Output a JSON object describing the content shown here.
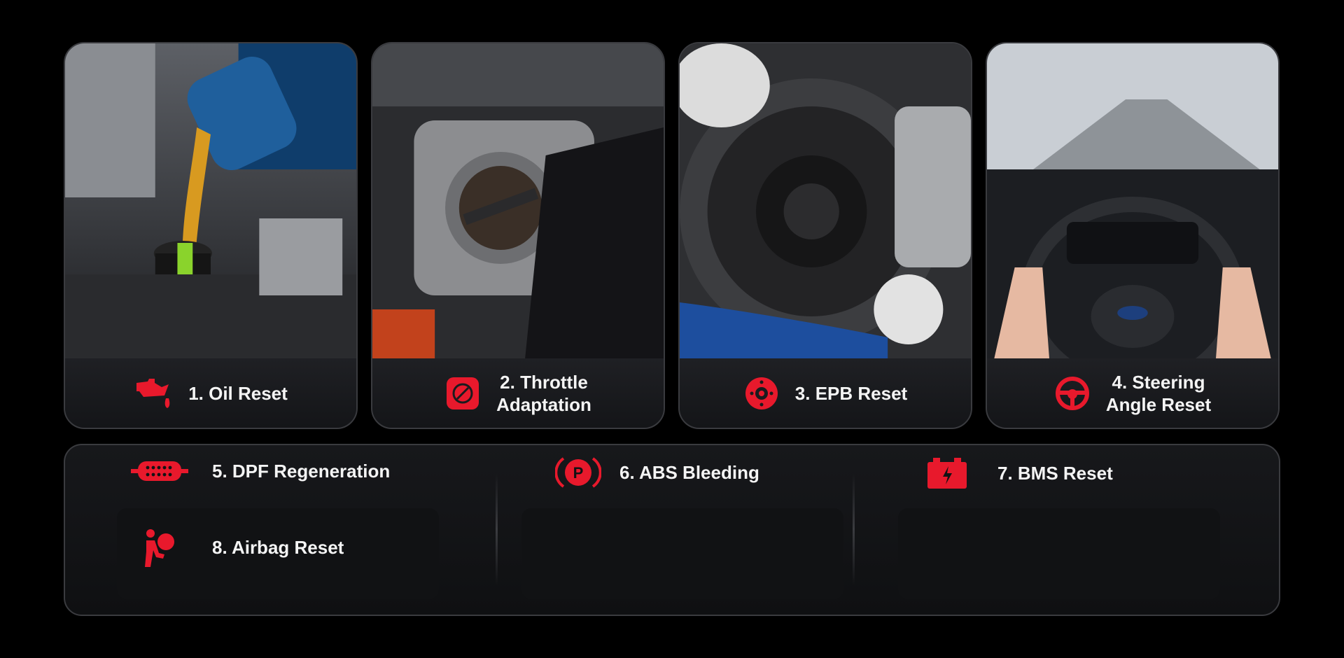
{
  "colors": {
    "accent": "#e8192c",
    "background": "#000000",
    "card": "#1a1b1e"
  },
  "cards": [
    {
      "label": "1. Oil Reset",
      "icon": "oil-can-icon",
      "image": "engine-oil-pouring-photo"
    },
    {
      "label": "2. Throttle\nAdaptation",
      "icon": "throttle-body-icon",
      "image": "throttle-body-photo"
    },
    {
      "label": "3. EPB Reset",
      "icon": "brake-disc-icon",
      "image": "brake-disc-photo"
    },
    {
      "label": "4. Steering\nAngle Reset",
      "icon": "steering-wheel-icon",
      "image": "driving-steering-wheel-photo"
    }
  ],
  "features": [
    {
      "label": "5. DPF Regeneration",
      "icon": "dpf-filter-icon"
    },
    {
      "label": "6. ABS Bleeding",
      "icon": "parking-brake-p-icon"
    },
    {
      "label": "7. BMS Reset",
      "icon": "battery-icon"
    },
    {
      "label": "8. Airbag Reset",
      "icon": "airbag-icon"
    }
  ]
}
